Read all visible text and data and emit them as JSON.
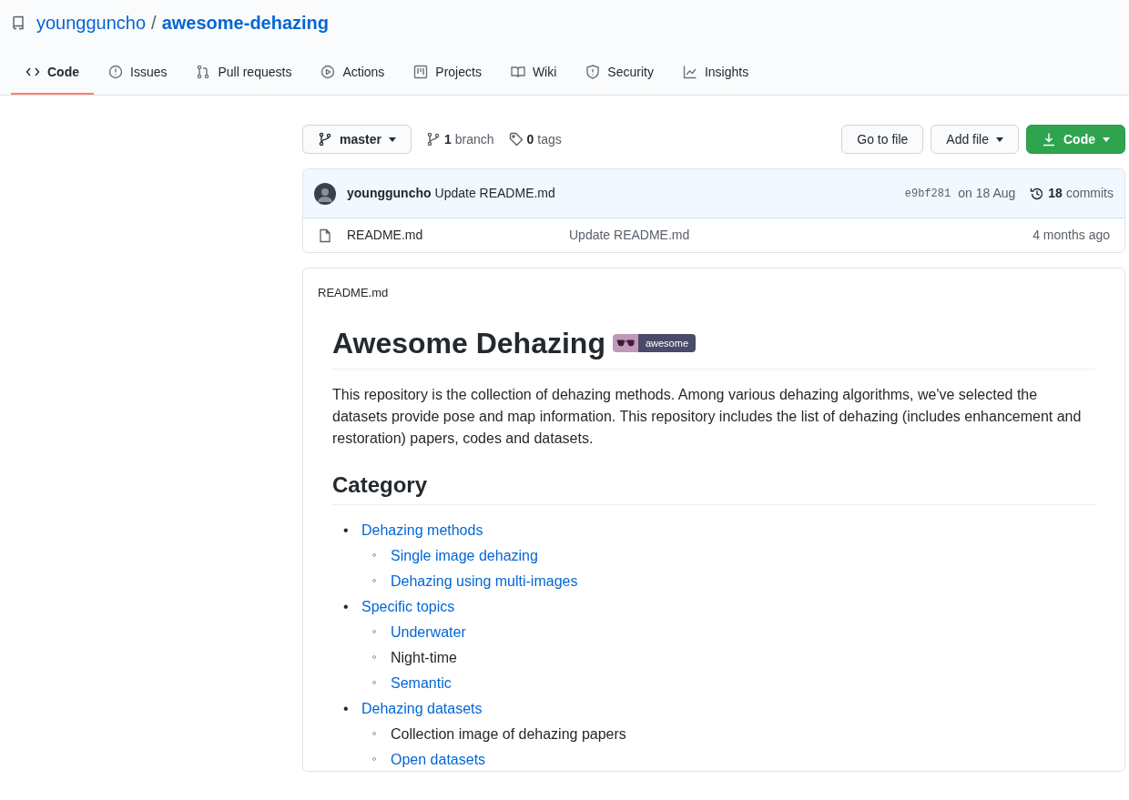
{
  "repo": {
    "owner": "youngguncho",
    "separator": "/",
    "name": "awesome-dehazing"
  },
  "tabs": [
    {
      "label": "Code",
      "selected": true
    },
    {
      "label": "Issues",
      "selected": false
    },
    {
      "label": "Pull requests",
      "selected": false
    },
    {
      "label": "Actions",
      "selected": false
    },
    {
      "label": "Projects",
      "selected": false
    },
    {
      "label": "Wiki",
      "selected": false
    },
    {
      "label": "Security",
      "selected": false
    },
    {
      "label": "Insights",
      "selected": false
    }
  ],
  "toolbar": {
    "branch_button": "master",
    "branch_count": "1",
    "branch_label": "branch",
    "tag_count": "0",
    "tag_label": "tags",
    "buttons": [
      {
        "label": "Go to file",
        "kind": "plain"
      },
      {
        "label": "Add file",
        "kind": "dropdown"
      },
      {
        "label": "Code",
        "kind": "primary"
      }
    ]
  },
  "commit": {
    "author": "youngguncho",
    "message": "Update README.md",
    "sha": "e9bf281",
    "date": "on 18 Aug",
    "commit_count": "18",
    "commit_label": "commits"
  },
  "files": [
    {
      "name": "README.md",
      "message": "Update README.md",
      "age": "4 months ago"
    }
  ],
  "readme": {
    "filename": "README.md",
    "title": "Awesome Dehazing",
    "badge": "awesome",
    "intro": "This repository is the collection of dehazing methods. Among various dehazing algorithms, we've selected the datasets provide pose and map information. This repository includes the list of dehazing (includes enhancement and restoration) papers, codes and datasets.",
    "category_heading": "Category",
    "categories": [
      {
        "marker": "•",
        "label": "Dehazing methods",
        "link": true,
        "children": [
          {
            "marker": "◦",
            "label": "Single image dehazing",
            "link": true
          },
          {
            "marker": "◦",
            "label": "Dehazing using multi-images",
            "link": true
          }
        ]
      },
      {
        "marker": "•",
        "label": "Specific topics",
        "link": true,
        "children": [
          {
            "marker": "◦",
            "label": "Underwater",
            "link": true
          },
          {
            "marker": "◦",
            "label": "Night-time",
            "link": false
          },
          {
            "marker": "◦",
            "label": "Semantic",
            "link": true
          }
        ]
      },
      {
        "marker": "•",
        "label": "Dehazing datasets",
        "link": true,
        "children": [
          {
            "marker": "◦",
            "label": "Collection image of dehazing papers",
            "link": false
          },
          {
            "marker": "◦",
            "label": "Open datasets",
            "link": true
          }
        ]
      }
    ]
  }
}
